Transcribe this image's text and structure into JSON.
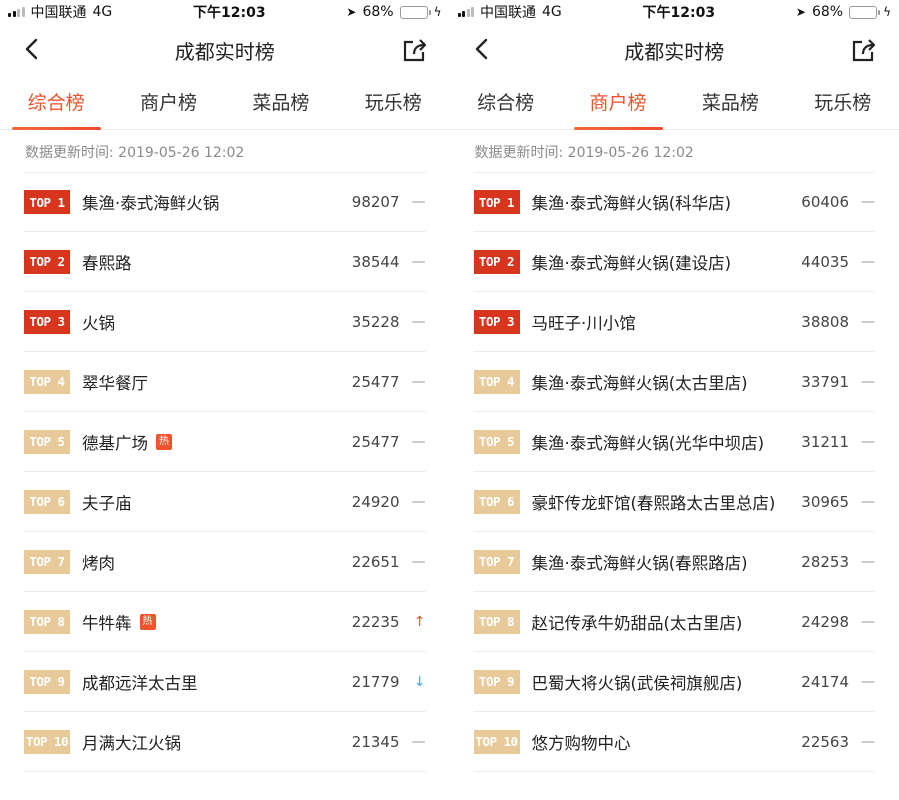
{
  "status": {
    "carrier": "中国联通",
    "network": "4G",
    "time": "下午12:03",
    "battery": "68%",
    "battery_level": 0.68
  },
  "colors": {
    "accent": "#f0542d",
    "top_badge": "#d8351f",
    "rest_badge": "#e8c99a",
    "down_arrow": "#4fa8de"
  },
  "left": {
    "nav_title": "成都实时榜",
    "tabs": [
      "综合榜",
      "商户榜",
      "菜品榜",
      "玩乐榜"
    ],
    "active_tab": 0,
    "updated": "数据更新时间: 2019-05-26 12:02",
    "items": [
      {
        "rank": "TOP 1",
        "name": "集渔·泰式海鲜火锅",
        "hot": "",
        "score": "98207",
        "trend": "—"
      },
      {
        "rank": "TOP 2",
        "name": "春熙路",
        "hot": "",
        "score": "38544",
        "trend": "—"
      },
      {
        "rank": "TOP 3",
        "name": "火锅",
        "hot": "",
        "score": "35228",
        "trend": "—"
      },
      {
        "rank": "TOP 4",
        "name": "翠华餐厅",
        "hot": "",
        "score": "25477",
        "trend": "—"
      },
      {
        "rank": "TOP 5",
        "name": "德基广场",
        "hot": "热",
        "score": "25477",
        "trend": "—"
      },
      {
        "rank": "TOP 6",
        "name": "夫子庙",
        "hot": "",
        "score": "24920",
        "trend": "—"
      },
      {
        "rank": "TOP 7",
        "name": "烤肉",
        "hot": "",
        "score": "22651",
        "trend": "—"
      },
      {
        "rank": "TOP 8",
        "name": "牛牪犇",
        "hot": "热",
        "score": "22235",
        "trend": "↑"
      },
      {
        "rank": "TOP 9",
        "name": "成都远洋太古里",
        "hot": "",
        "score": "21779",
        "trend": "↓"
      },
      {
        "rank": "TOP 10",
        "name": "月满大江火锅",
        "hot": "",
        "score": "21345",
        "trend": "—"
      }
    ]
  },
  "right": {
    "nav_title": "成都实时榜",
    "tabs": [
      "综合榜",
      "商户榜",
      "菜品榜",
      "玩乐榜"
    ],
    "active_tab": 1,
    "updated": "数据更新时间: 2019-05-26 12:02",
    "items": [
      {
        "rank": "TOP 1",
        "name": "集渔·泰式海鲜火锅(科华店)",
        "hot": "",
        "score": "60406",
        "trend": "—"
      },
      {
        "rank": "TOP 2",
        "name": "集渔·泰式海鲜火锅(建设店)",
        "hot": "",
        "score": "44035",
        "trend": "—"
      },
      {
        "rank": "TOP 3",
        "name": "马旺子·川小馆",
        "hot": "",
        "score": "38808",
        "trend": "—"
      },
      {
        "rank": "TOP 4",
        "name": "集渔·泰式海鲜火锅(太古里店)",
        "hot": "",
        "score": "33791",
        "trend": "—"
      },
      {
        "rank": "TOP 5",
        "name": "集渔·泰式海鲜火锅(光华中坝店)",
        "hot": "",
        "score": "31211",
        "trend": "—"
      },
      {
        "rank": "TOP 6",
        "name": "豪虾传龙虾馆(春熙路太古里总店)",
        "hot": "",
        "score": "30965",
        "trend": "—"
      },
      {
        "rank": "TOP 7",
        "name": "集渔·泰式海鲜火锅(春熙路店)",
        "hot": "",
        "score": "28253",
        "trend": "—"
      },
      {
        "rank": "TOP 8",
        "name": "赵记传承牛奶甜品(太古里店)",
        "hot": "",
        "score": "24298",
        "trend": "—"
      },
      {
        "rank": "TOP 9",
        "name": "巴蜀大将火锅(武侯祠旗舰店)",
        "hot": "",
        "score": "24174",
        "trend": "—"
      },
      {
        "rank": "TOP 10",
        "name": "悠方购物中心",
        "hot": "",
        "score": "22563",
        "trend": "—"
      }
    ]
  }
}
